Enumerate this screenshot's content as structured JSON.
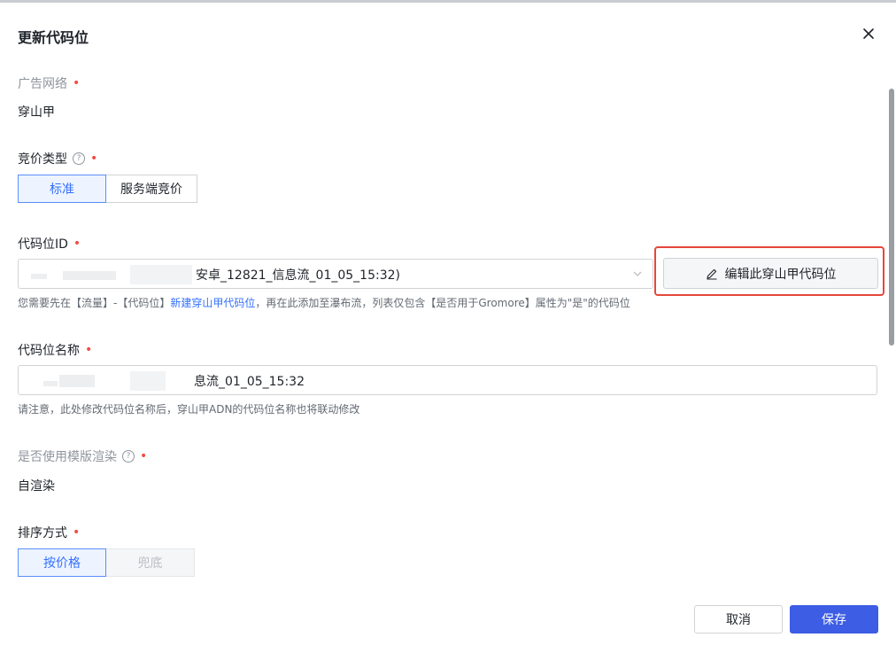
{
  "dialog": {
    "title": "更新代码位"
  },
  "fields": {
    "network": {
      "label": "广告网络",
      "value": "穿山甲"
    },
    "bidding": {
      "label": "竞价类型",
      "options": [
        "标准",
        "服务端竞价"
      ],
      "selected": "标准"
    },
    "slot_id": {
      "label": "代码位ID",
      "value_visible": "安卓_12821_信息流_01_05_15:32)",
      "edit_button": "编辑此穿山甲代码位",
      "hint_prefix": "您需要先在【流量】-【代码位】",
      "hint_link": "新建穿山甲代码位",
      "hint_suffix": "，再在此添加至瀑布流，列表仅包含【是否用于Gromore】属性为\"是\"的代码位"
    },
    "slot_name": {
      "label": "代码位名称",
      "value_visible": "息流_01_05_15:32",
      "hint": "请注意，此处修改代码位名称后，穿山甲ADN的代码位名称也将联动修改"
    },
    "template": {
      "label": "是否使用模版渲染",
      "value": "自渲染"
    },
    "sort": {
      "label": "排序方式",
      "options": [
        "按价格",
        "兜底"
      ],
      "selected": "按价格"
    }
  },
  "footer": {
    "cancel": "取消",
    "save": "保存"
  },
  "colors": {
    "primary": "#3D5DE5",
    "link": "#3370FF",
    "required": "#F54A45",
    "highlight": "#E5473B"
  },
  "icons": {
    "close": "close-icon",
    "help": "question-circle-icon",
    "dropdown": "chevron-down-icon",
    "edit": "pencil-icon"
  }
}
